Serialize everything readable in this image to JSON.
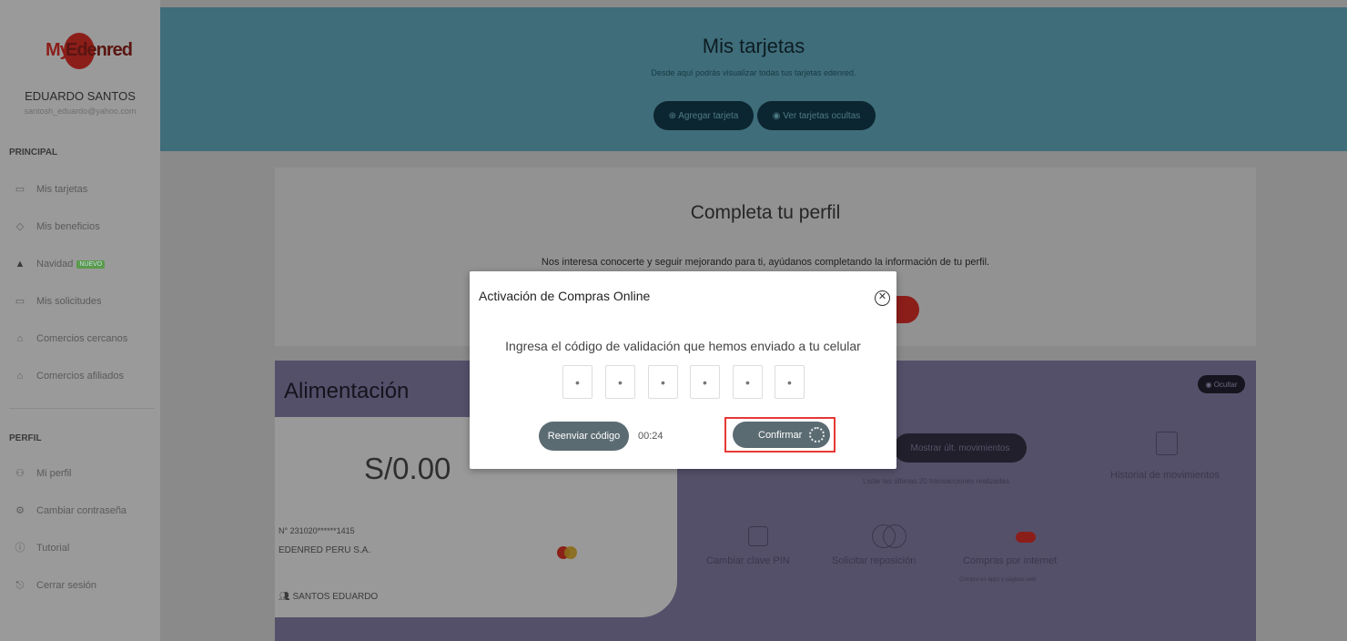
{
  "sidebar": {
    "logo_left": "My",
    "logo_right": "Edenred",
    "user_name": "EDUARDO SANTOS",
    "user_email": "santosh_eduardo@yahoo.com",
    "section_principal": "PRINCIPAL",
    "principal_items": [
      {
        "label": "Mis tarjetas",
        "icon": "card-icon"
      },
      {
        "label": "Mis beneficios",
        "icon": "tag-icon"
      },
      {
        "label": "Navidad",
        "icon": "tree-icon",
        "badge": "NUEVO"
      },
      {
        "label": "Mis solicitudes",
        "icon": "card-icon"
      },
      {
        "label": "Comercios cercanos",
        "icon": "location-icon"
      },
      {
        "label": "Comercios afiliados",
        "icon": "store-icon"
      }
    ],
    "section_perfil": "PERFIL",
    "perfil_items": [
      {
        "label": "Mi perfil",
        "icon": "user-icon"
      },
      {
        "label": "Cambiar contraseña",
        "icon": "gear-icon"
      },
      {
        "label": "Tutorial",
        "icon": "info-icon"
      },
      {
        "label": "Cerrar sesión",
        "icon": "logout-icon"
      }
    ]
  },
  "header": {
    "title": "Mis tarjetas",
    "subtitle": "Desde aquí podrás visualizar todas tus tarjetas edenred.",
    "add_card": "⊕ Agregar tarjeta",
    "hidden_cards": "◉ Ver tarjetas ocultas"
  },
  "profile": {
    "title": "Completa tu perfil",
    "text": "Nos interesa conocerte y seguir mejorando para ti, ayúdanos completando la información de tu perfil."
  },
  "benefit": {
    "name": "Alimentación",
    "balance": "S/0.00",
    "card_number": "N° 231020******1415",
    "company": "EDENRED PERU S.A.",
    "holder": "SANTOS EDUARDO",
    "hide": "◉ Ocultar",
    "show_movements": "Mostrar últ. movimientos",
    "movements_sub": "Listar las últimas 20 transacciones realizadas",
    "history": "Historial de movimientos",
    "change_pin": "Cambiar clave PIN",
    "replacement": "Solicitar reposición",
    "internet": "Compras por internet",
    "internet_sub": "Compra en apps y páginas web"
  },
  "modal": {
    "title": "Activación de Compras Online",
    "instruction": "Ingresa el código de validación que hemos enviado a tu celular",
    "otp_placeholder": "•",
    "resend": "Reenviar código",
    "timer": "00:24",
    "confirm": "Confirmar"
  }
}
